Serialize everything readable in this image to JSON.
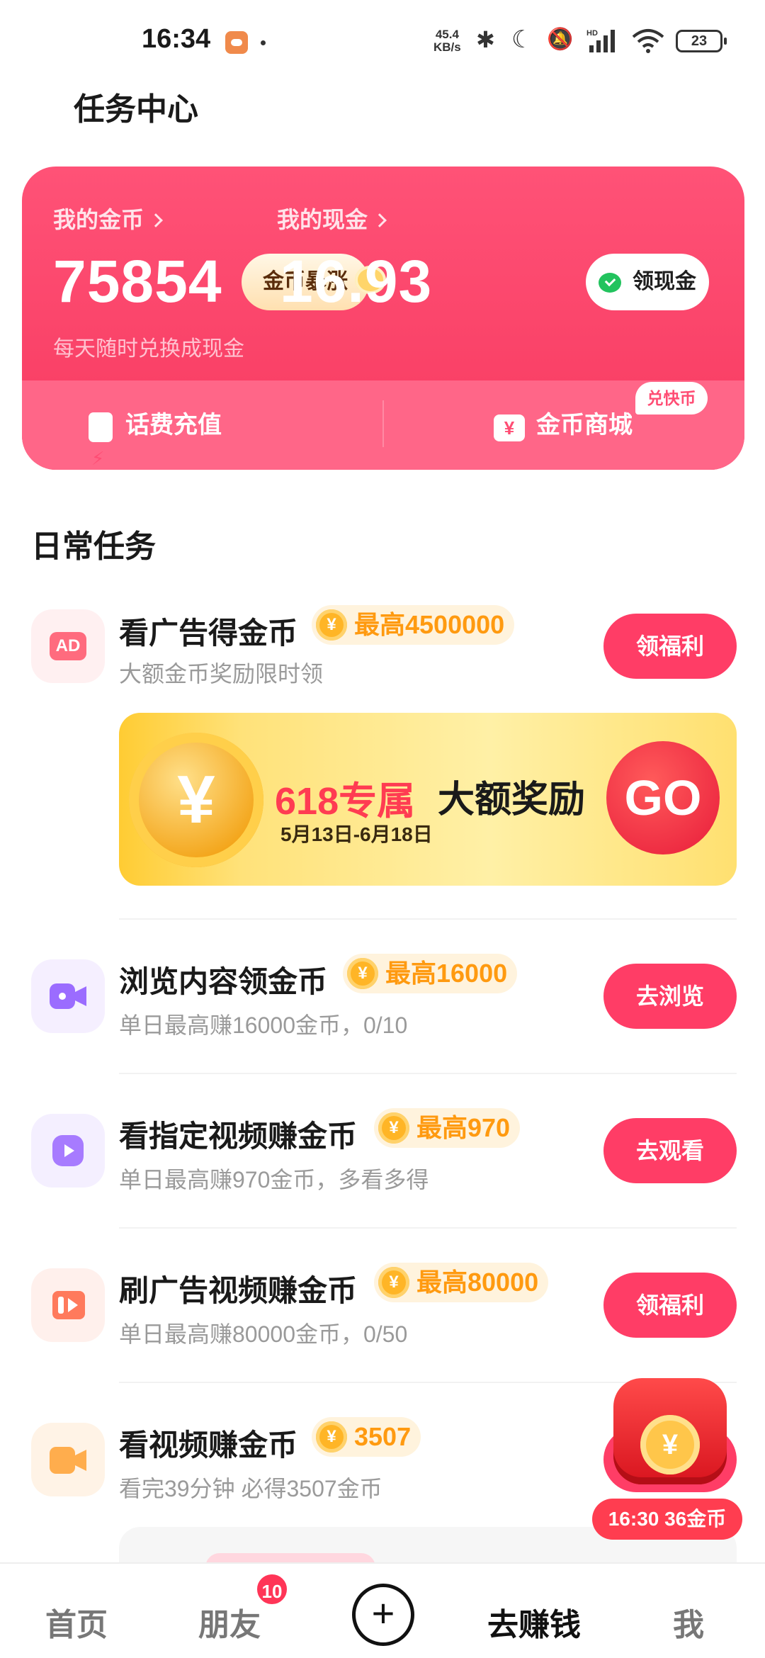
{
  "status_bar": {
    "time": "16:34",
    "net_speed_value": "45.4",
    "net_speed_unit": "KB/s",
    "battery": "23",
    "icons": [
      "app-notification-icon",
      "bluetooth-icon",
      "moon-icon",
      "mute-icon",
      "hd-signal-icon",
      "wifi-icon",
      "battery-icon"
    ]
  },
  "header": {
    "title": "任务中心"
  },
  "wallet": {
    "coins_label": "我的金币",
    "coins_value": "75854",
    "coins_badge": "金币暴涨",
    "cash_label": "我的现金",
    "cash_value": "16.93",
    "cash_button": "领现金",
    "subtitle": "每天随时兑换成现金",
    "recharge_label": "话费充值",
    "mall_label": "金币商城",
    "mall_badge": "兑快币"
  },
  "daily": {
    "title": "日常任务",
    "tasks": [
      {
        "title": "看广告得金币",
        "reward": "最高4500000",
        "subtitle": "大额金币奖励限时领",
        "button": "领福利",
        "icon": "ad-icon",
        "icon_text": "AD"
      },
      {
        "title": "浏览内容领金币",
        "reward": "最高16000",
        "subtitle": "单日最高赚16000金币，0/10",
        "button": "去浏览",
        "icon": "video-camera-icon"
      },
      {
        "title": "看指定视频赚金币",
        "reward": "最高970",
        "subtitle": "单日最高赚970金币，多看多得",
        "button": "去观看",
        "icon": "play-icon"
      },
      {
        "title": "刷广告视频赚金币",
        "reward": "最高80000",
        "subtitle": "单日最高赚80000金币，0/50",
        "button": "领福利",
        "icon": "ad-video-icon"
      },
      {
        "title": "看视频赚金币",
        "reward": "3507",
        "subtitle": "看完39分钟 必得3507金币",
        "button": "",
        "icon": "video-icon"
      }
    ]
  },
  "banner": {
    "title_red": "618专属",
    "title_black": "大额奖励",
    "date": "5月13日-6月18日",
    "go": "GO",
    "coin_symbol": "¥"
  },
  "floating": {
    "timer": "16:30 36金币",
    "coin_symbol": "¥"
  },
  "coin_symbol": "¥",
  "nav": {
    "home": "首页",
    "friends": "朋友",
    "friends_badge": "10",
    "plus": "+",
    "earn": "去赚钱",
    "me": "我"
  },
  "colors": {
    "accent": "#ff3d66",
    "card": "#f73a60",
    "reward": "#ff9a10"
  }
}
